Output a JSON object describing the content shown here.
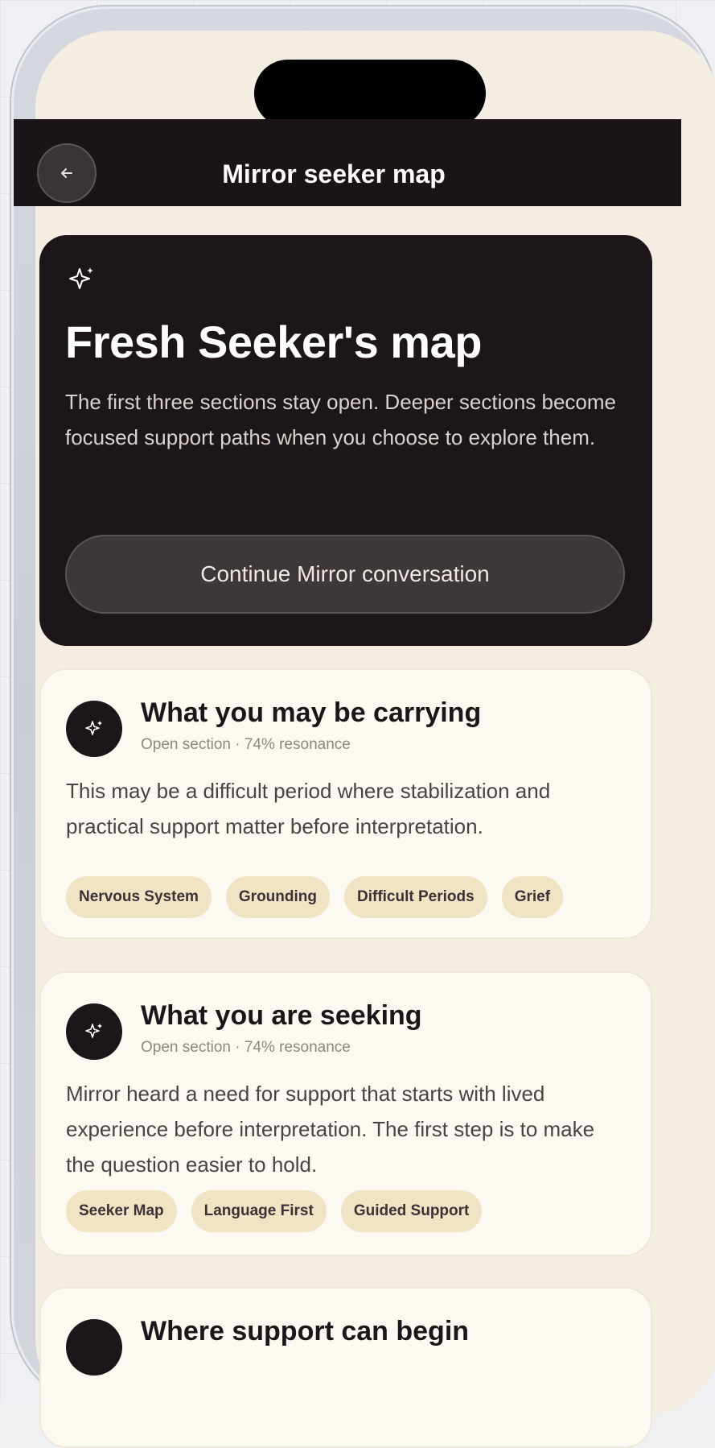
{
  "header": {
    "title": "Mirror seeker map"
  },
  "hero": {
    "title": "Fresh Seeker's map",
    "description": "The first three sections stay open. Deeper sections become focused support paths when you choose to explore them.",
    "button_label": "Continue Mirror conversation"
  },
  "sections": [
    {
      "title": "What you may be carrying",
      "meta": "Open section · 74% resonance",
      "body": "This may be a difficult period where stabilization and practical support matter before interpretation.",
      "tags": [
        "Nervous System",
        "Grounding",
        "Difficult Periods",
        "Grief"
      ]
    },
    {
      "title": "What you are seeking",
      "meta": "Open section · 74% resonance",
      "body": "Mirror heard a need for support that starts with lived experience before interpretation. The first step is to make the question easier to hold.",
      "tags": [
        "Seeker Map",
        "Language First",
        "Guided Support"
      ]
    },
    {
      "title": "Where support can begin"
    }
  ],
  "colors": {
    "background": "#f4ede2",
    "dark": "#1c161b",
    "chip": "#f1e4c4"
  },
  "icons": {
    "back": "arrow-left-icon",
    "sparkle": "sparkle-icon"
  }
}
